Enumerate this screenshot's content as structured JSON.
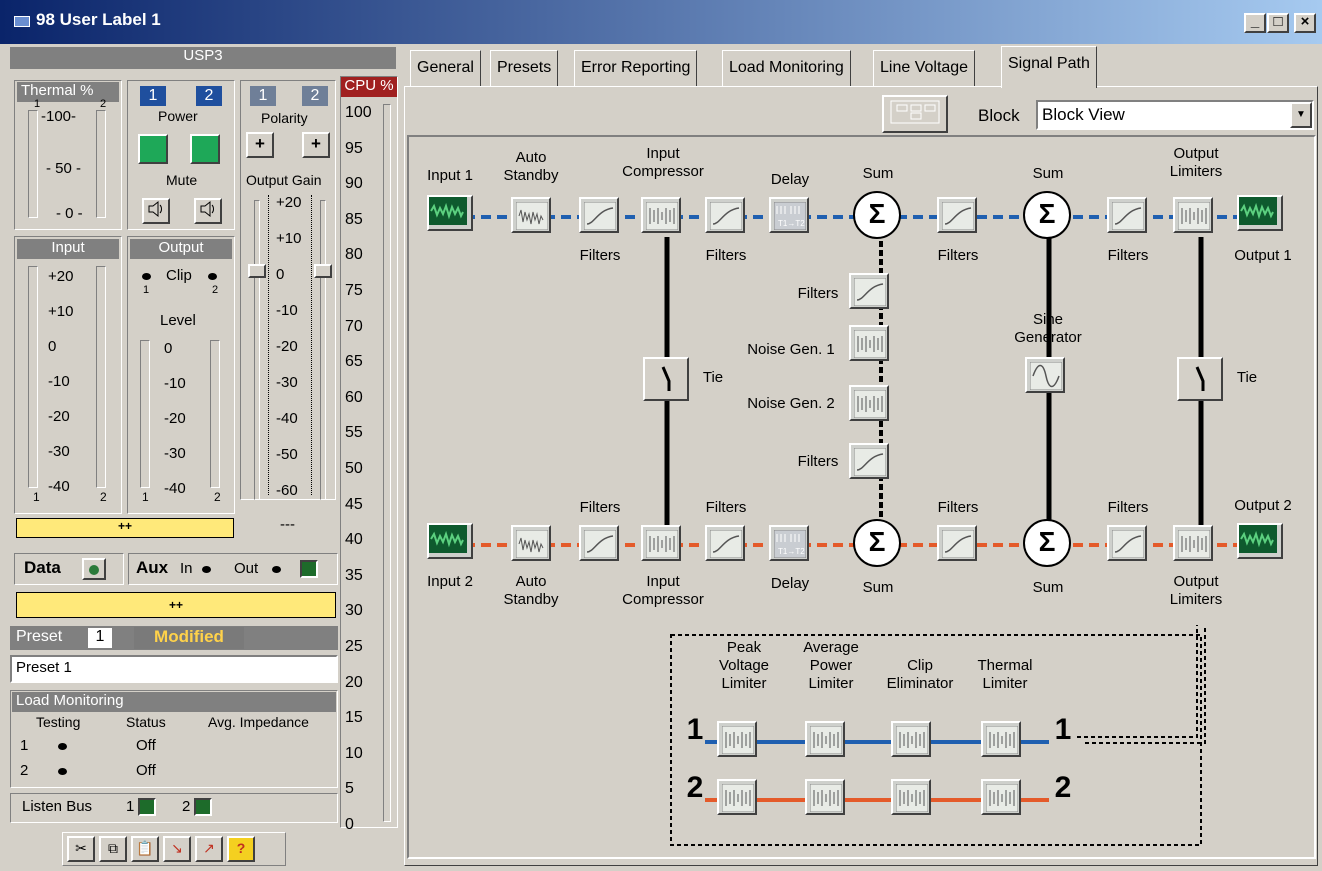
{
  "window": {
    "title": "98 User Label 1",
    "min": "_",
    "max": "□",
    "close": "×"
  },
  "device": {
    "name": "USP3"
  },
  "thermal": {
    "label": "Thermal %",
    "ch1": "1",
    "ch2": "2",
    "ticks": [
      "-100-",
      "- 50 -",
      "- 0 -"
    ]
  },
  "power": {
    "ch1": "1",
    "ch2": "2",
    "label": "Power",
    "mute_label": "Mute"
  },
  "polarity": {
    "ch1": "1",
    "ch2": "2",
    "label": "Polarity",
    "plus": "+"
  },
  "output_gain": {
    "label": "Output Gain",
    "ticks": [
      "+20",
      "+10",
      "0",
      "-10",
      "-20",
      "-30",
      "-40",
      "-50",
      "-60"
    ],
    "bottom": "---"
  },
  "cpu": {
    "label": "CPU %",
    "ticks": [
      "100",
      "95",
      "90",
      "85",
      "80",
      "75",
      "70",
      "65",
      "60",
      "55",
      "50",
      "45",
      "40",
      "35",
      "30",
      "25",
      "20",
      "15",
      "10",
      "5",
      "0"
    ]
  },
  "input": {
    "label": "Input",
    "ticks": [
      "+20",
      "+10",
      "0",
      "-10",
      "-20",
      "-30",
      "-40"
    ],
    "ch1": "1",
    "ch2": "2"
  },
  "output": {
    "label": "Output",
    "clip": "Clip",
    "c1": "1",
    "c2": "2",
    "level": "Level",
    "ticks": [
      "0",
      "-10",
      "-20",
      "-30",
      "-40"
    ],
    "ch1": "1",
    "ch2": "2"
  },
  "bar1": "++",
  "bar2": "++",
  "data_row": {
    "data": "Data",
    "aux": "Aux",
    "in": "In",
    "out": "Out"
  },
  "preset": {
    "label": "Preset",
    "number": "1",
    "status": "Modified",
    "name": "Preset 1"
  },
  "load_monitoring": {
    "title": "Load Monitoring",
    "testing": "Testing",
    "status": "Status",
    "avg": "Avg. Impedance",
    "rows": [
      {
        "ch": "1",
        "status": "Off"
      },
      {
        "ch": "2",
        "status": "Off"
      }
    ]
  },
  "listen_bus": {
    "label": "Listen Bus",
    "ch1": "1",
    "ch2": "2"
  },
  "tabs": [
    "General",
    "Presets",
    "Error Reporting",
    "Load Monitoring",
    "Line Voltage",
    "Signal Path"
  ],
  "block": {
    "label": "Block",
    "value": "Block View"
  },
  "diagram": {
    "input1": "Input 1",
    "input2": "Input 2",
    "output1": "Output 1",
    "output2": "Output 2",
    "auto_standby": "Auto\nStandby",
    "input_compressor": "Input\nCompressor",
    "delay": "Delay",
    "sum": "Sum",
    "filters": "Filters",
    "output_limiters": "Output\nLimiters",
    "tie": "Tie",
    "noise1": "Noise Gen. 1",
    "noise2": "Noise Gen. 2",
    "sine": "Sine\nGenerator",
    "peak": "Peak\nVoltage\nLimiter",
    "avg": "Average\nPower\nLimiter",
    "clip": "Clip\nEliminator",
    "thermal": "Thermal\nLimiter",
    "n1": "1",
    "n2": "2",
    "sigma": "Σ"
  }
}
